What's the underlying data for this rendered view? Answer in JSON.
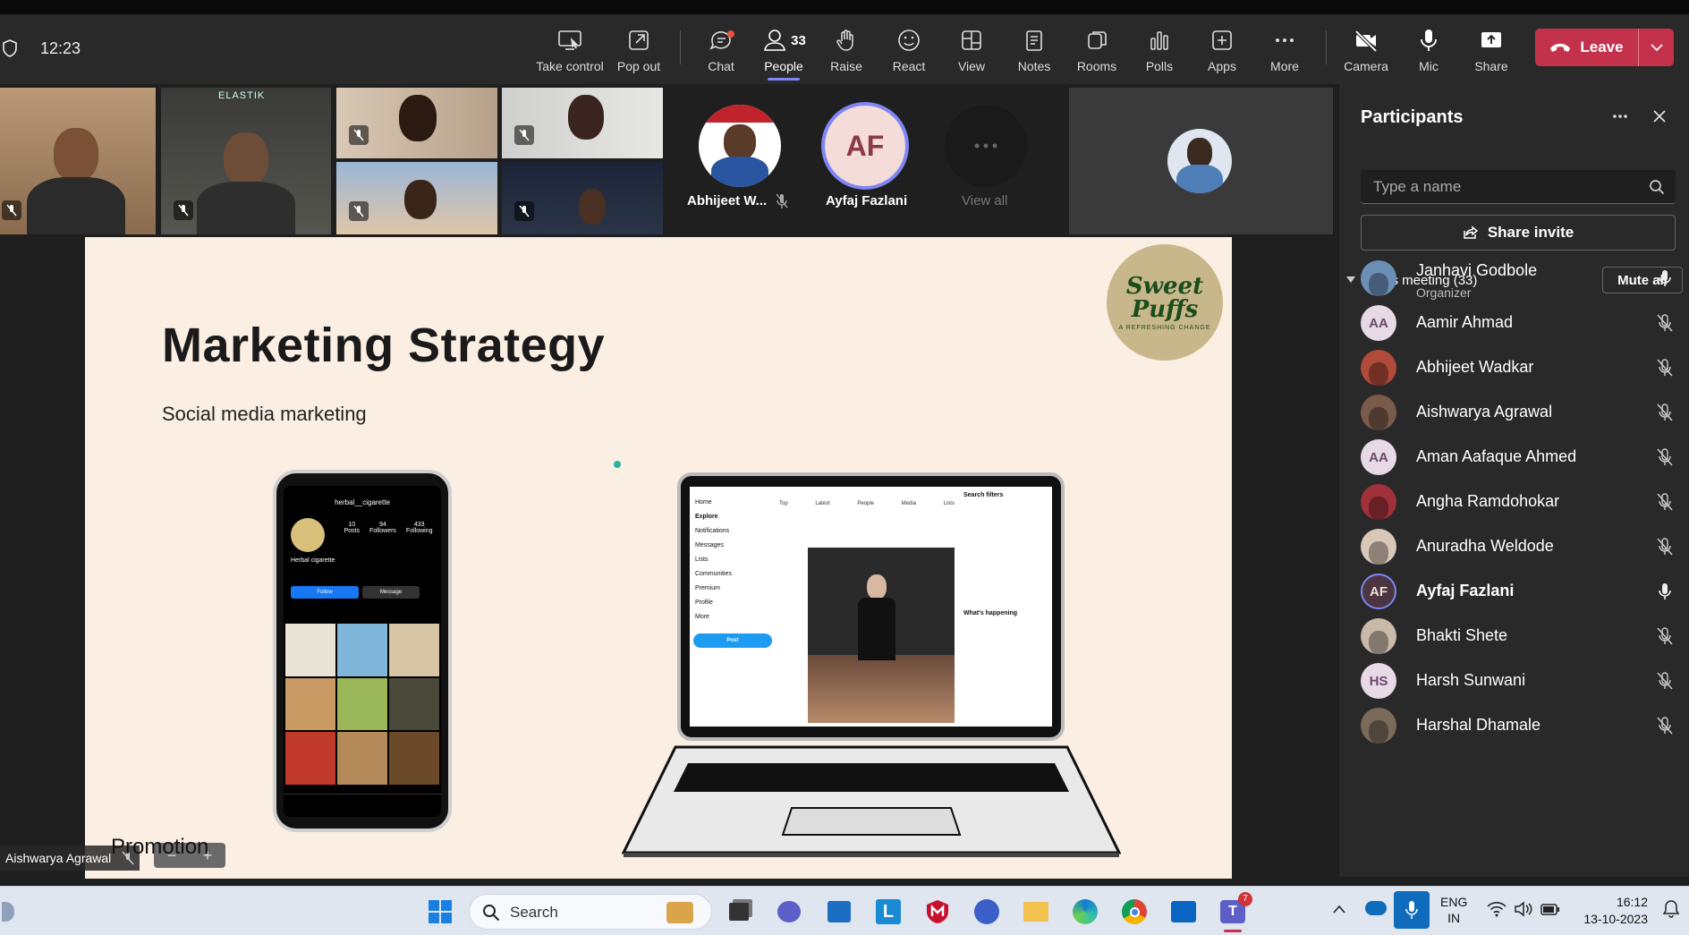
{
  "clock": "12:23",
  "toolbar": {
    "take_control": "Take control",
    "pop_out": "Pop out",
    "chat": "Chat",
    "people": "People",
    "people_count": "33",
    "raise": "Raise",
    "react": "React",
    "view": "View",
    "notes": "Notes",
    "rooms": "Rooms",
    "polls": "Polls",
    "apps": "Apps",
    "more": "More",
    "camera": "Camera",
    "mic": "Mic",
    "share": "Share",
    "leave": "Leave"
  },
  "gallery": {
    "tile2_banner": "ELASTIK",
    "avatars": [
      {
        "name": "Abhijeet W...",
        "initials": ""
      },
      {
        "name": "Ayfaj Fazlani",
        "initials": "AF"
      },
      {
        "name": "View all",
        "initials": ""
      }
    ]
  },
  "slide": {
    "title": "Marketing Strategy",
    "subtitle": "Social media marketing",
    "logo_text": "Sweet Puffs",
    "logo_tagline": "A REFRESHING CHANGE",
    "phone_handle": "herbal__cigarette",
    "phone_stats": [
      {
        "n": "10",
        "l": "Posts"
      },
      {
        "n": "94",
        "l": "Followers"
      },
      {
        "n": "433",
        "l": "Following"
      }
    ],
    "phone_bio_name": "Herbal cigarette",
    "phone_follow": "Follow",
    "phone_message": "Message",
    "laptop_nav": [
      "Home",
      "Explore",
      "Notifications",
      "Messages",
      "Lists",
      "Communities",
      "Premium",
      "Profile",
      "More"
    ],
    "laptop_post": "Post",
    "laptop_tabs": [
      "Top",
      "Latest",
      "People",
      "Media",
      "Lists"
    ],
    "laptop_filters": "Search filters",
    "laptop_happening": "What's happening"
  },
  "presenter": {
    "name": "Aishwarya Agrawal",
    "promo": "Promotion"
  },
  "participants": {
    "title": "Participants",
    "search_placeholder": "Type a name",
    "share_invite": "Share invite",
    "section": "In this meeting (33)",
    "mute_all": "Mute all",
    "list": [
      {
        "name": "Janhavi Godbole",
        "role": "Organizer",
        "initials": "",
        "mic": "on",
        "color": "#6b8fb5"
      },
      {
        "name": "Aamir Ahmad",
        "role": "",
        "initials": "AA",
        "mic": "off",
        "color": "#3a4a6b"
      },
      {
        "name": "Abhijeet Wadkar",
        "role": "",
        "initials": "",
        "mic": "off",
        "color": "#b04a3a"
      },
      {
        "name": "Aishwarya Agrawal",
        "role": "",
        "initials": "",
        "mic": "off",
        "color": "#7a5a4a"
      },
      {
        "name": "Aman Aafaque Ahmed",
        "role": "",
        "initials": "AA",
        "mic": "off",
        "color": "#6b3a3a"
      },
      {
        "name": "Angha Ramdohokar",
        "role": "",
        "initials": "",
        "mic": "off",
        "color": "#a0303a"
      },
      {
        "name": "Anuradha Weldode",
        "role": "",
        "initials": "",
        "mic": "off",
        "color": "#d9c7b8"
      },
      {
        "name": "Ayfaj Fazlani",
        "role": "",
        "initials": "AF",
        "mic": "on",
        "color": "#4a3540"
      },
      {
        "name": "Bhakti Shete",
        "role": "",
        "initials": "",
        "mic": "off",
        "color": "#c9b9a9"
      },
      {
        "name": "Harsh Sunwani",
        "role": "",
        "initials": "HS",
        "mic": "off",
        "color": "#5a3a3a"
      },
      {
        "name": "Harshal Dhamale",
        "role": "",
        "initials": "",
        "mic": "off",
        "color": "#7a6a5a"
      }
    ]
  },
  "taskbar": {
    "search": "Search",
    "lang_line1": "ENG",
    "lang_line2": "IN",
    "time": "16:12",
    "date": "13-10-2023",
    "teams_badge": "7"
  }
}
